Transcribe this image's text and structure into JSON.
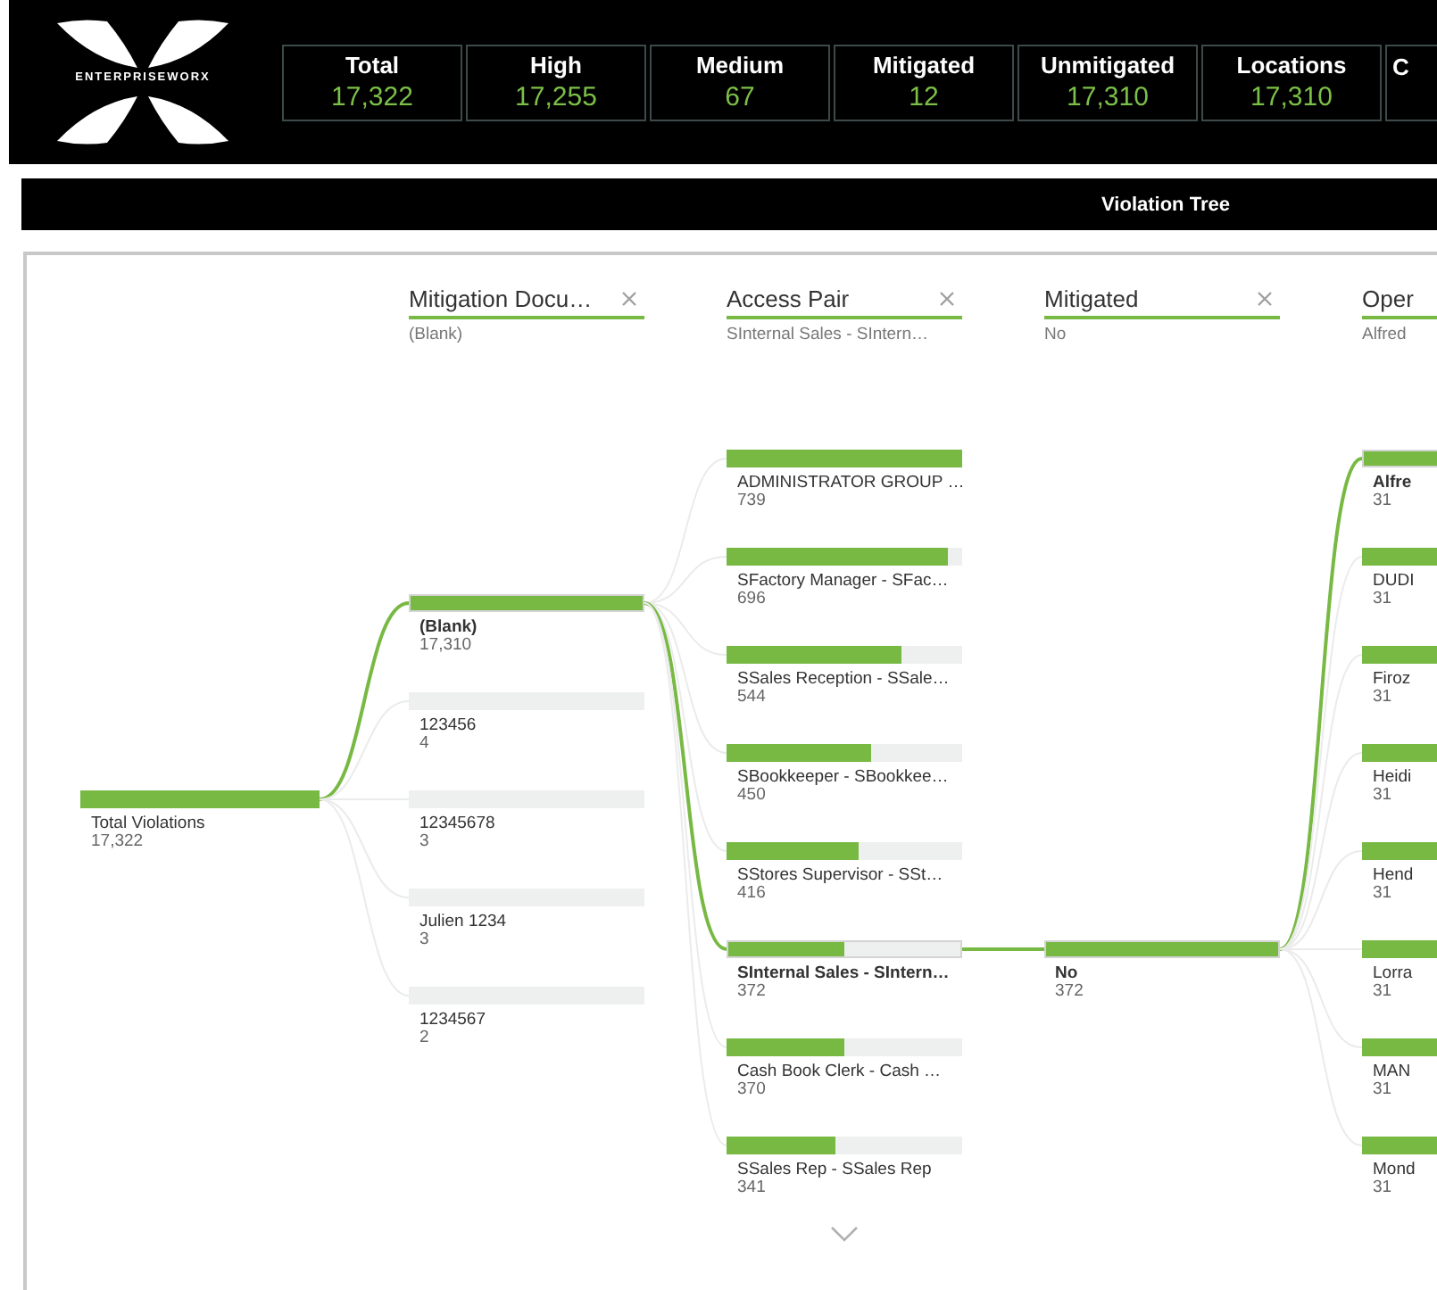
{
  "header": {
    "logo": "ENTERPRISEWORX",
    "kpis": [
      {
        "label": "Total",
        "value": "17,322"
      },
      {
        "label": "High",
        "value": "17,255"
      },
      {
        "label": "Medium",
        "value": "67"
      },
      {
        "label": "Mitigated",
        "value": "12"
      },
      {
        "label": "Unmitigated",
        "value": "17,310"
      },
      {
        "label": "Locations",
        "value": "17,310"
      },
      {
        "label": "C"
      }
    ]
  },
  "title_bar": {
    "title": "Violation Tree"
  },
  "tree": {
    "root": {
      "label": "Total Violations",
      "value": "17,322",
      "level": 1
    },
    "levels": [
      {
        "heading": "Mitigation Docu…",
        "closable": true,
        "selection": "(Blank)",
        "has_more": false,
        "nodes": [
          {
            "label": "(Blank)",
            "value": "17,310",
            "level": 1,
            "selected": true
          },
          {
            "label": "123456",
            "value": "4",
            "level": 0,
            "selected": false
          },
          {
            "label": "12345678",
            "value": "3",
            "level": 0,
            "selected": false
          },
          {
            "label": "Julien 1234",
            "value": "3",
            "level": 0,
            "selected": false
          },
          {
            "label": "1234567",
            "value": "2",
            "level": 0,
            "selected": false
          }
        ]
      },
      {
        "heading": "Access Pair",
        "closable": true,
        "selection": "SInternal Sales - SIntern…",
        "has_more": true,
        "nodes": [
          {
            "label": "ADMINISTRATOR GROUP …",
            "value": "739",
            "level": 1,
            "selected": false
          },
          {
            "label": "SFactory Manager - SFac…",
            "value": "696",
            "level": 0.94,
            "selected": false
          },
          {
            "label": "SSales Reception - SSale…",
            "value": "544",
            "level": 0.74,
            "selected": false
          },
          {
            "label": "SBookkeeper - SBookkee…",
            "value": "450",
            "level": 0.61,
            "selected": false
          },
          {
            "label": "SStores Supervisor - SSt…",
            "value": "416",
            "level": 0.56,
            "selected": false
          },
          {
            "label": "SInternal Sales - SIntern…",
            "value": "372",
            "level": 0.5,
            "selected": true
          },
          {
            "label": "Cash Book Clerk - Cash …",
            "value": "370",
            "level": 0.5,
            "selected": false
          },
          {
            "label": "SSales Rep - SSales Rep",
            "value": "341",
            "level": 0.46,
            "selected": false
          }
        ]
      },
      {
        "heading": "Mitigated",
        "closable": true,
        "selection": "No",
        "has_more": false,
        "nodes": [
          {
            "label": "No",
            "value": "372",
            "level": 1,
            "selected": true
          }
        ]
      },
      {
        "heading": "Oper",
        "closable": false,
        "selection": "Alfred",
        "has_more": false,
        "nodes": [
          {
            "label": "Alfre",
            "value": "31",
            "level": 1,
            "selected": true
          },
          {
            "label": "DUDI",
            "value": "31",
            "level": 1,
            "selected": false
          },
          {
            "label": "Firoz",
            "value": "31",
            "level": 1,
            "selected": false
          },
          {
            "label": "Heidi",
            "value": "31",
            "level": 1,
            "selected": false
          },
          {
            "label": "Hend",
            "value": "31",
            "level": 1,
            "selected": false
          },
          {
            "label": "Lorra",
            "value": "31",
            "level": 1,
            "selected": false
          },
          {
            "label": "MAN",
            "value": "31",
            "level": 1,
            "selected": false
          },
          {
            "label": "Mond",
            "value": "31",
            "level": 1,
            "selected": false
          }
        ]
      }
    ]
  }
}
